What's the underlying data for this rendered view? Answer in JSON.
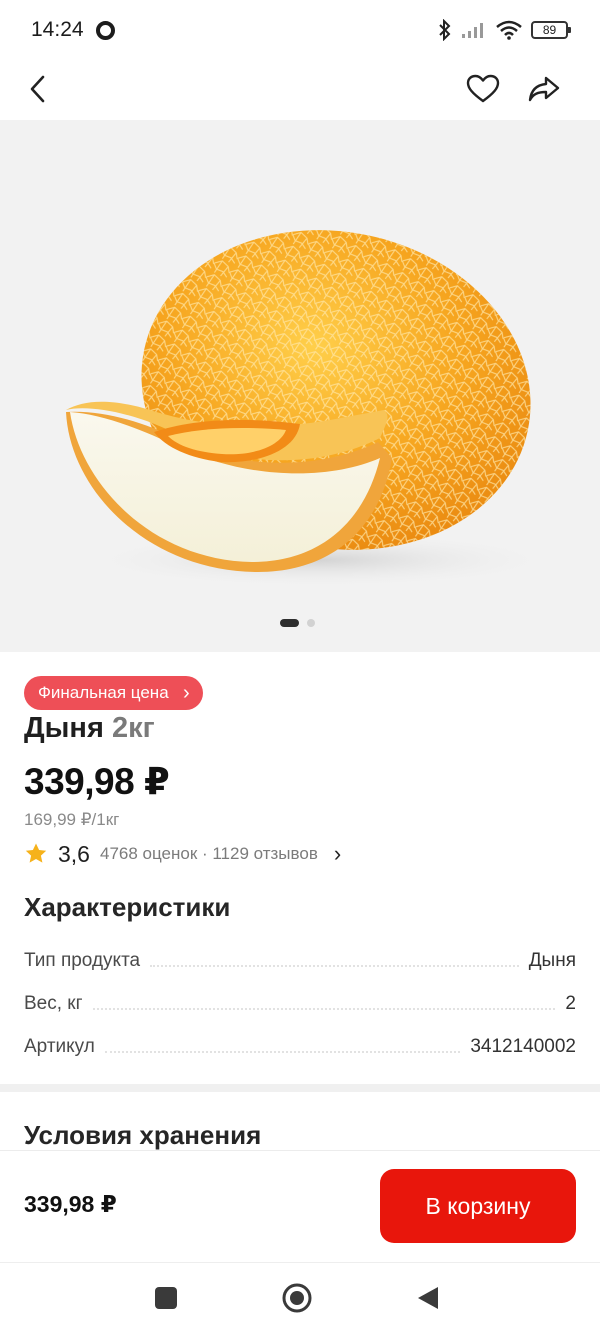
{
  "status_bar": {
    "time": "14:24",
    "battery": "89",
    "icons": [
      "circle-icon",
      "bluetooth-icon",
      "signal-icon",
      "wifi-icon",
      "battery-icon"
    ]
  },
  "nav": {
    "back_icon": "chevron-left-icon",
    "favorite_icon": "heart-icon",
    "share_icon": "share-icon"
  },
  "gallery": {
    "image": "melon-photo",
    "pages": 2,
    "current_page": 1
  },
  "product": {
    "badge": "Финальная цена",
    "name": "Дыня",
    "weight": "2кг",
    "price": "339,98 ₽",
    "unit_price": "169,99 ₽/1кг",
    "rating": "3,6",
    "rating_info": "4768 оценок · 1129 отзывов"
  },
  "specs": {
    "title": "Характеристики",
    "rows": [
      {
        "label": "Тип продукта",
        "value": "Дыня"
      },
      {
        "label": "Вес, кг",
        "value": "2"
      },
      {
        "label": "Артикул",
        "value": "3412140002"
      }
    ]
  },
  "storage": {
    "title": "Условия хранения"
  },
  "buy_bar": {
    "price": "339,98 ₽",
    "button_label": "В корзину"
  },
  "colors": {
    "badge": "#ee4f57",
    "cart_button": "#e8160c",
    "star": "#f6b21b"
  }
}
